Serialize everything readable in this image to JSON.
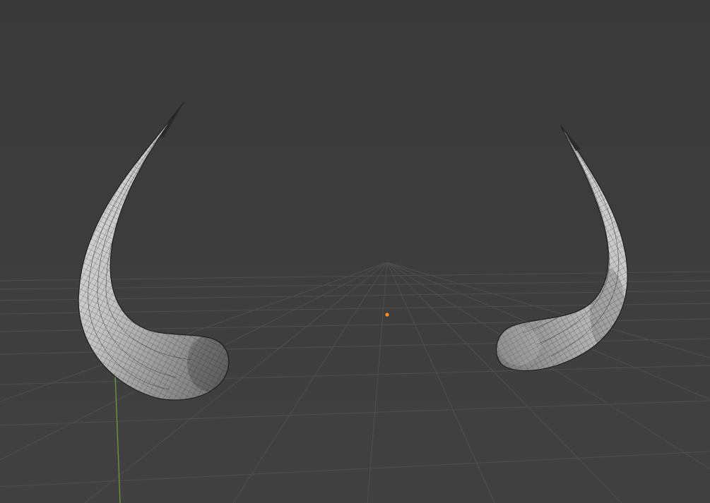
{
  "viewport": {
    "view_type": "3D Viewport",
    "shading": "solid-wireframe",
    "colors": {
      "background_top": "#3a3a3a",
      "background_bottom": "#404040",
      "grid_line": "#555555",
      "axis_y": "#6b9a3a",
      "origin": "#ff8c1a",
      "mesh_light": "#dcdcdc",
      "mesh_mid": "#a9a9a9",
      "mesh_dark": "#4a4a4a",
      "wire": "#2b2b2b"
    },
    "objects": [
      {
        "name": "horn-left",
        "selected": false
      },
      {
        "name": "horn-right",
        "selected": false
      }
    ],
    "origin_point": {
      "visible": true
    }
  }
}
